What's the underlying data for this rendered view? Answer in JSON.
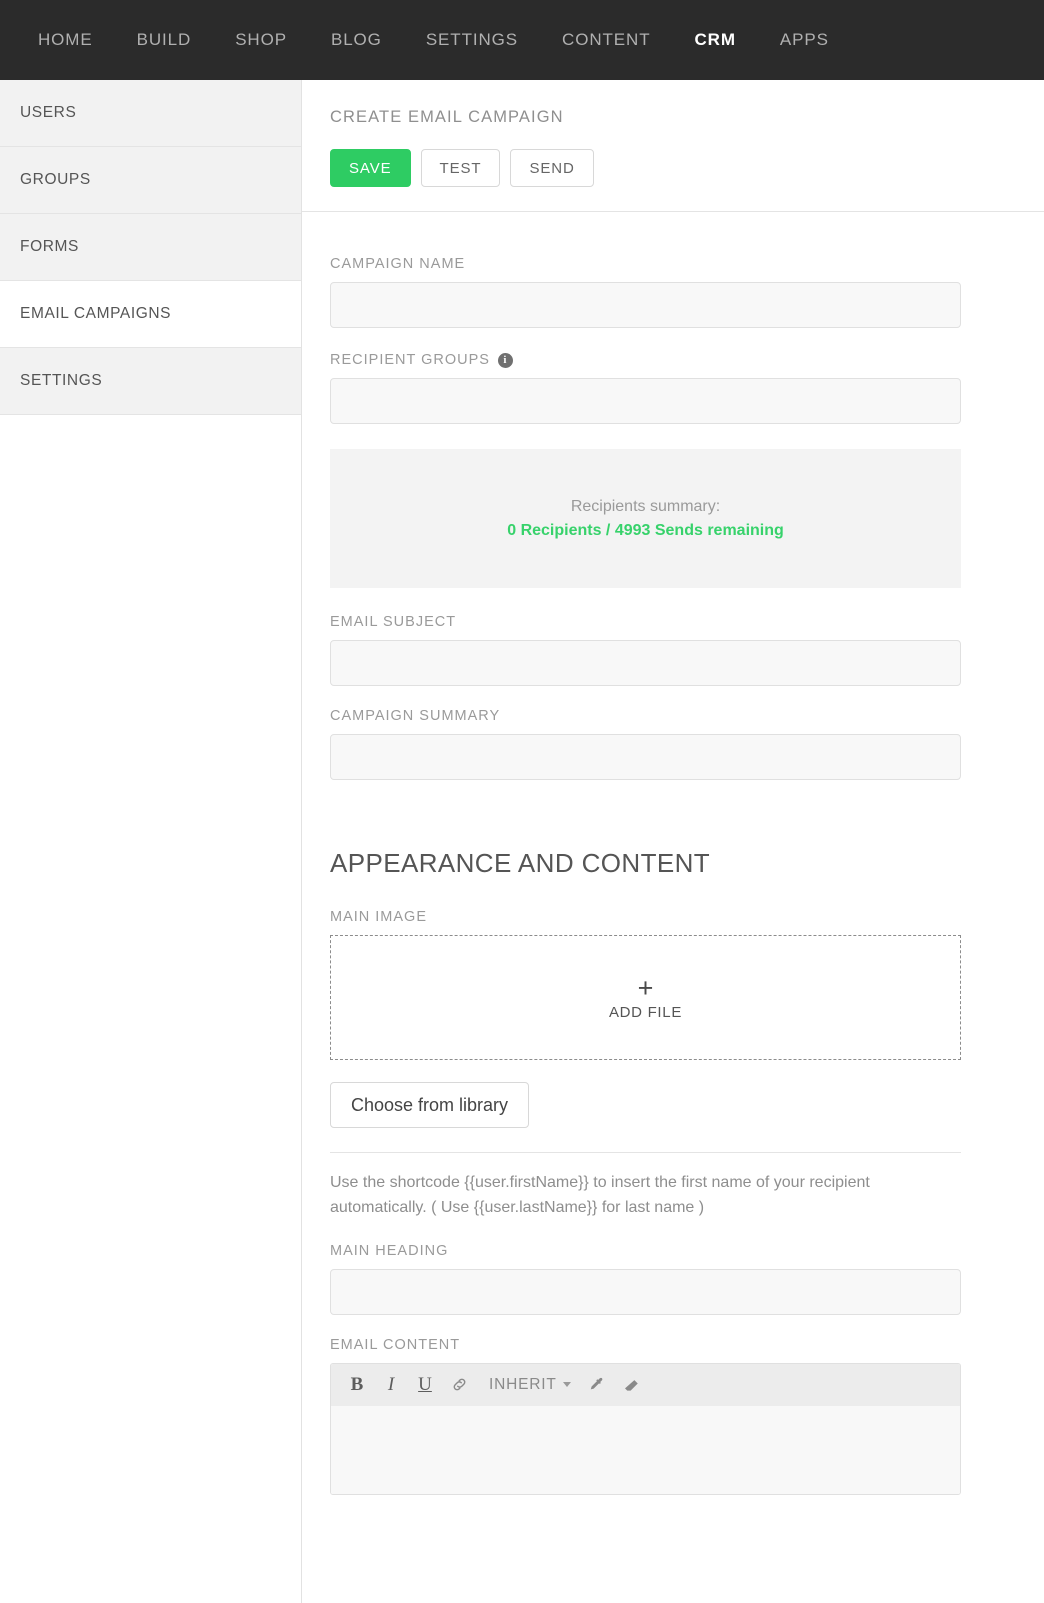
{
  "topnav": {
    "items": [
      {
        "label": "HOME",
        "active": false
      },
      {
        "label": "BUILD",
        "active": false
      },
      {
        "label": "SHOP",
        "active": false
      },
      {
        "label": "BLOG",
        "active": false
      },
      {
        "label": "SETTINGS",
        "active": false
      },
      {
        "label": "CONTENT",
        "active": false
      },
      {
        "label": "CRM",
        "active": true
      },
      {
        "label": "APPS",
        "active": false
      }
    ]
  },
  "sidebar": {
    "items": [
      {
        "label": "USERS",
        "active": false
      },
      {
        "label": "GROUPS",
        "active": false
      },
      {
        "label": "FORMS",
        "active": false
      },
      {
        "label": "EMAIL CAMPAIGNS",
        "active": true
      },
      {
        "label": "SETTINGS",
        "active": false
      }
    ]
  },
  "page": {
    "title": "CREATE EMAIL CAMPAIGN",
    "actions": {
      "save": "SAVE",
      "test": "TEST",
      "send": "SEND"
    }
  },
  "form": {
    "campaign_name": {
      "label": "CAMPAIGN NAME",
      "value": "",
      "placeholder": ""
    },
    "recipient_groups": {
      "label": "RECIPIENT GROUPS",
      "value": "",
      "placeholder": "",
      "info_icon": "info-icon"
    },
    "recipients_summary": {
      "label": "Recipients summary:",
      "value": "0 Recipients / 4993 Sends remaining",
      "recipients_count": 0,
      "sends_remaining": 4993
    },
    "email_subject": {
      "label": "EMAIL SUBJECT",
      "value": "",
      "placeholder": ""
    },
    "campaign_summary": {
      "label": "CAMPAIGN SUMMARY",
      "value": "",
      "placeholder": ""
    }
  },
  "appearance": {
    "heading": "APPEARANCE AND CONTENT",
    "main_image": {
      "label": "MAIN IMAGE",
      "dropzone_plus": "+",
      "dropzone_label": "ADD FILE",
      "library_button": "Choose from library"
    },
    "shortcode_help": "Use the shortcode {{user.firstName}} to insert the first name of your recipient automatically. ( Use {{user.lastName}} for last name )",
    "main_heading": {
      "label": "MAIN HEADING",
      "value": "",
      "placeholder": ""
    },
    "email_content": {
      "label": "EMAIL CONTENT",
      "value": "",
      "toolbar": {
        "bold": "B",
        "italic": "I",
        "underline": "U",
        "link_icon": "link-icon",
        "format_select": "INHERIT",
        "eyedropper_icon": "eyedropper-icon",
        "eraser_icon": "eraser-icon"
      }
    }
  },
  "colors": {
    "nav_background": "#2b2b2b",
    "accent_green": "#2ecc63",
    "summary_green": "#37d26b",
    "sidebar_item": "#f2f2f2",
    "input_fill": "#f8f8f8"
  }
}
